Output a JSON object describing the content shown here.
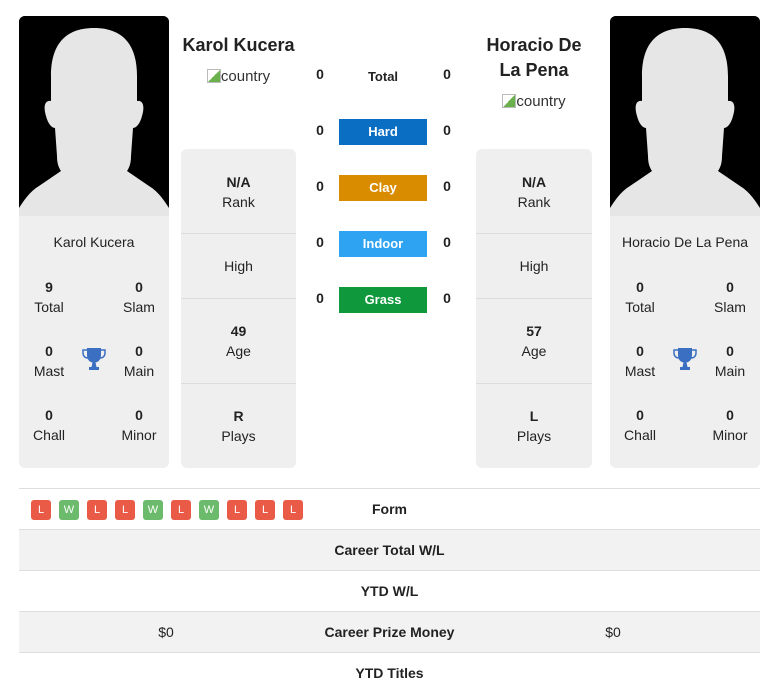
{
  "colors": {
    "hard": "#0a6ec2",
    "clay": "#d98c00",
    "indoor": "#2ea3f2",
    "grass": "#10983c",
    "win": "#6cbb6c",
    "loss": "#ea5b47",
    "trophy": "#3a6fc2"
  },
  "player1": {
    "name": "Karol Kucera",
    "country_alt": "country",
    "card_name": "Karol Kucera",
    "titles": [
      {
        "value": "9",
        "label": "Total"
      },
      {
        "value": "0",
        "label": "Slam"
      },
      {
        "value": "0",
        "label": "Mast"
      },
      {
        "value": "0",
        "label": "Main"
      },
      {
        "value": "0",
        "label": "Chall"
      },
      {
        "value": "0",
        "label": "Minor"
      }
    ],
    "info": {
      "rank_value": "N/A",
      "rank_label": "Rank",
      "high_label": "High",
      "age_value": "49",
      "age_label": "Age",
      "plays_value": "R",
      "plays_label": "Plays"
    }
  },
  "player2": {
    "name": "Horacio De La Pena",
    "country_alt": "country",
    "card_name": "Horacio De La Pena",
    "titles": [
      {
        "value": "0",
        "label": "Total"
      },
      {
        "value": "0",
        "label": "Slam"
      },
      {
        "value": "0",
        "label": "Mast"
      },
      {
        "value": "0",
        "label": "Main"
      },
      {
        "value": "0",
        "label": "Chall"
      },
      {
        "value": "0",
        "label": "Minor"
      }
    ],
    "info": {
      "rank_value": "N/A",
      "rank_label": "Rank",
      "high_label": "High",
      "age_value": "57",
      "age_label": "Age",
      "plays_value": "L",
      "plays_label": "Plays"
    }
  },
  "h2h": {
    "total": {
      "label": "Total",
      "p1": "0",
      "p2": "0"
    },
    "surfaces": [
      {
        "label": "Hard",
        "p1": "0",
        "p2": "0"
      },
      {
        "label": "Clay",
        "p1": "0",
        "p2": "0"
      },
      {
        "label": "Indoor",
        "p1": "0",
        "p2": "0"
      },
      {
        "label": "Grass",
        "p1": "0",
        "p2": "0"
      }
    ]
  },
  "comparison": {
    "form": {
      "label": "Form",
      "p1": [
        "L",
        "W",
        "L",
        "L",
        "W",
        "L",
        "W",
        "L",
        "L",
        "L"
      ]
    },
    "rows": [
      {
        "label": "Career Total W/L",
        "p1": "",
        "p2": ""
      },
      {
        "label": "YTD W/L",
        "p1": "",
        "p2": ""
      },
      {
        "label": "Career Prize Money",
        "p1": "$0",
        "p2": "$0"
      },
      {
        "label": "YTD Titles",
        "p1": "",
        "p2": ""
      }
    ]
  }
}
